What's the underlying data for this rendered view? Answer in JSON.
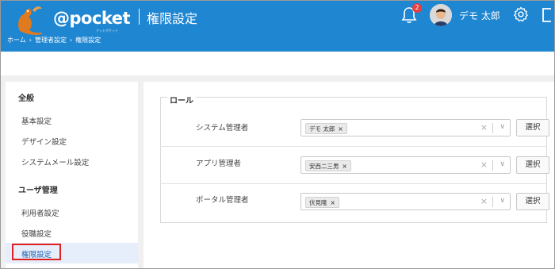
{
  "app": {
    "logo_text": "@pocket",
    "logo_sub": "アットポケット",
    "page_title": "権限設定"
  },
  "breadcrumb": [
    "ホーム",
    "管理者設定",
    "権限設定"
  ],
  "header": {
    "notification_count": "2",
    "user_name": "デモ 太郎",
    "icons": [
      "bell-icon",
      "avatar",
      "gear-icon",
      "logout-icon"
    ]
  },
  "sidebar": {
    "groups": [
      {
        "title": "全般",
        "items": [
          "基本設定",
          "デザイン設定",
          "システムメール設定"
        ]
      },
      {
        "title": "ユーザ管理",
        "items": [
          "利用者設定",
          "役職設定",
          "権限設定"
        ]
      }
    ],
    "active_item": "権限設定"
  },
  "roles": {
    "legend": "ロール",
    "rows": [
      {
        "label": "システム管理者",
        "chip": "デモ 太郎",
        "button": "選択"
      },
      {
        "label": "アプリ管理者",
        "chip": "安西二三男",
        "button": "選択"
      },
      {
        "label": "ポータル管理者",
        "chip": "伏見隆",
        "button": "選択"
      }
    ]
  },
  "colors": {
    "header_bg": "#1f86d2",
    "highlight_border": "#e02020",
    "badge": "#e83e3e"
  }
}
